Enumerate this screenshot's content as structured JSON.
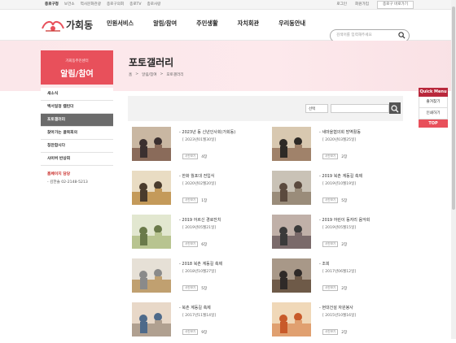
{
  "topbar": {
    "left": [
      "종로구청",
      "보건소",
      "역사문화관광",
      "종로구의회",
      "종로TV",
      "종로사랑"
    ],
    "right": [
      "로그인",
      "회원가입",
      "종로구 바로가기"
    ]
  },
  "header": {
    "logo_text": "가회동",
    "menu": [
      "민원서비스",
      "알림/참여",
      "주민생활",
      "자치회관",
      "우리동안내"
    ],
    "search_placeholder": "검색어를 입력해주세요"
  },
  "sidebar": {
    "subtitle": "가회동주민센터",
    "title": "알림/참여",
    "items": [
      {
        "label": "새소식",
        "active": false
      },
      {
        "label": "백서일정 캘린더",
        "active": false
      },
      {
        "label": "포토갤러리",
        "active": true
      },
      {
        "label": "찾아가는 골목회의",
        "active": false
      },
      {
        "label": "칭찬합시다",
        "active": false
      },
      {
        "label": "사이버 반상회",
        "active": false
      }
    ],
    "contact_title": "홈페이지 담당",
    "contact_person": "- 김한솔 02-2148-5213"
  },
  "page": {
    "title": "포토갤러리",
    "breadcrumb": [
      "홈",
      ">",
      "알림/참여",
      ">",
      "포토갤러리"
    ]
  },
  "filter": {
    "select_value": "선택",
    "input_value": ""
  },
  "gallery": [
    {
      "title": "- 2023년 동 신년인사회(가회동)",
      "date": "[ 2023년01월30일]",
      "badge": "사진보기",
      "count": "4장"
    },
    {
      "title": "- 새마을협의회 방역활동",
      "date": "[ 2020년03월25일]",
      "badge": "사진보기",
      "count": "2장"
    },
    {
      "title": "- 한화 월포대 전입식",
      "date": "[ 2020년02월20일]",
      "badge": "사진보기",
      "count": "1장"
    },
    {
      "title": "- 2019 북촌 계동길 축제",
      "date": "[ 2019년10월19일]",
      "badge": "사진보기",
      "count": "5장"
    },
    {
      "title": "- 2019 어르신 경로잔치",
      "date": "[ 2019년05월21일]",
      "badge": "사진보기",
      "count": "6장"
    },
    {
      "title": "- 2019 어린이 동자리 음악회",
      "date": "[ 2019년05월15일]",
      "badge": "사진보기",
      "count": "2장"
    },
    {
      "title": "- 2018 북촌 계동길 축제",
      "date": "[ 2018년10월27일]",
      "badge": "사진보기",
      "count": "5장"
    },
    {
      "title": "- 조회",
      "date": "[ 2017년06월12일]",
      "badge": "사진보기",
      "count": "2장"
    },
    {
      "title": "- 북촌 계동길 축제",
      "date": "[ 2017년11월14일]",
      "badge": "사진보기",
      "count": "9장"
    },
    {
      "title": "- 현대건설 자원봉사",
      "date": "[ 2015년10월16일]",
      "badge": "사진보기",
      "count": "2장"
    }
  ],
  "quick_menu": {
    "title": "Quick Menu",
    "items": [
      "즐겨찾기",
      "인쇄하기"
    ],
    "top": "TOP"
  },
  "colors": {
    "accent": "#e8505b",
    "quick_header": "#b9283c",
    "band": "#fbe7ea"
  }
}
